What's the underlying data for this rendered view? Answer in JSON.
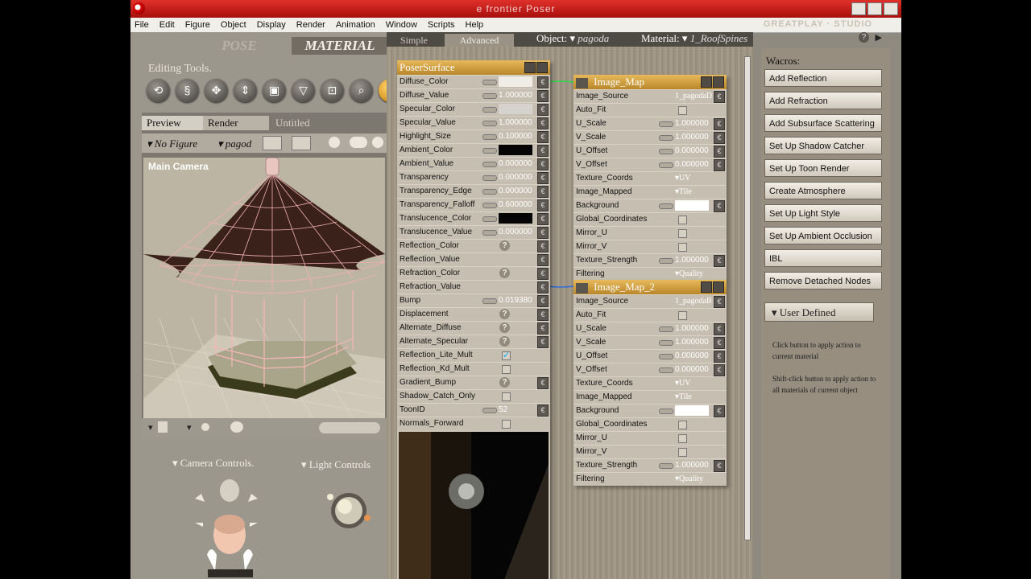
{
  "window": {
    "title": "e frontier Poser",
    "brand": "GREATPLAY · STUDIO"
  },
  "menu": [
    "File",
    "Edit",
    "Figure",
    "Object",
    "Display",
    "Render",
    "Animation",
    "Window",
    "Scripts",
    "Help"
  ],
  "rooms": {
    "pose": "POSE",
    "material": "MATERIAL"
  },
  "left": {
    "editing_label": "Editing Tools.",
    "tabs": {
      "preview": "Preview",
      "render": "Render",
      "untitled": "Untitled"
    },
    "figure_select": "No Figure",
    "object_select": "pagod",
    "camera_label": "Main Camera",
    "camera_controls": "Camera Controls.",
    "light_controls": "Light Controls"
  },
  "material_room": {
    "tabs": {
      "simple": "Simple",
      "advanced": "Advanced"
    },
    "object_label": "Object:",
    "object_value": "pagoda",
    "material_label": "Material:",
    "material_value": "1_RoofSpines"
  },
  "poser_surface": {
    "title": "PoserSurface",
    "rows": [
      {
        "label": "Diffuse_Color",
        "type": "color",
        "color": "#f0ede6"
      },
      {
        "label": "Diffuse_Value",
        "type": "num",
        "value": "1.000000"
      },
      {
        "label": "Specular_Color",
        "type": "color",
        "color": "#d6d3ce"
      },
      {
        "label": "Specular_Value",
        "type": "num",
        "value": "1.000000"
      },
      {
        "label": "Highlight_Size",
        "type": "num",
        "value": "0.100000"
      },
      {
        "label": "Ambient_Color",
        "type": "color",
        "color": "#050505"
      },
      {
        "label": "Ambient_Value",
        "type": "num",
        "value": "0.000000"
      },
      {
        "label": "Transparency",
        "type": "num",
        "value": "0.000000"
      },
      {
        "label": "Transparency_Edge",
        "type": "num",
        "value": "0.000000"
      },
      {
        "label": "Transparency_Falloff",
        "type": "num",
        "value": "0.600000"
      },
      {
        "label": "Translucence_Color",
        "type": "color",
        "color": "#050505"
      },
      {
        "label": "Translucence_Value",
        "type": "num",
        "value": "0.000000"
      },
      {
        "label": "Reflection_Color",
        "type": "q"
      },
      {
        "label": "Reflection_Value",
        "type": "none"
      },
      {
        "label": "Refraction_Color",
        "type": "q"
      },
      {
        "label": "Refraction_Value",
        "type": "none"
      },
      {
        "label": "Bump",
        "type": "num",
        "value": "0.019380"
      },
      {
        "label": "Displacement",
        "type": "q"
      },
      {
        "label": "Alternate_Diffuse",
        "type": "q"
      },
      {
        "label": "Alternate_Specular",
        "type": "q"
      },
      {
        "label": "Reflection_Lite_Mult",
        "type": "check",
        "checked": true
      },
      {
        "label": "Reflection_Kd_Mult",
        "type": "check",
        "checked": false
      },
      {
        "label": "Gradient_Bump",
        "type": "q"
      },
      {
        "label": "Shadow_Catch_Only",
        "type": "check",
        "checked": false
      },
      {
        "label": "ToonID",
        "type": "num",
        "value": "52"
      },
      {
        "label": "Normals_Forward",
        "type": "check",
        "checked": false
      }
    ]
  },
  "image_maps": [
    {
      "title": "Image_Map",
      "rows": [
        {
          "label": "Image_Source",
          "type": "text",
          "value": "1_pagodaD"
        },
        {
          "label": "Auto_Fit",
          "type": "check",
          "checked": false
        },
        {
          "label": "U_Scale",
          "type": "num",
          "value": "1.000000"
        },
        {
          "label": "V_Scale",
          "type": "num",
          "value": "1.000000"
        },
        {
          "label": "U_Offset",
          "type": "num",
          "value": "0.000000"
        },
        {
          "label": "V_Offset",
          "type": "num",
          "value": "0.000000"
        },
        {
          "label": "Texture_Coords",
          "type": "dd",
          "value": "UV"
        },
        {
          "label": "Image_Mapped",
          "type": "dd",
          "value": "Tile"
        },
        {
          "label": "Background",
          "type": "color",
          "color": "#ffffff"
        },
        {
          "label": "Global_Coordinates",
          "type": "check",
          "checked": false
        },
        {
          "label": "Mirror_U",
          "type": "check",
          "checked": false
        },
        {
          "label": "Mirror_V",
          "type": "check",
          "checked": false
        },
        {
          "label": "Texture_Strength",
          "type": "num",
          "value": "1.000000"
        },
        {
          "label": "Filtering",
          "type": "dd",
          "value": "Quality"
        }
      ]
    },
    {
      "title": "Image_Map_2",
      "rows": [
        {
          "label": "Image_Source",
          "type": "text",
          "value": "1_pagodaB"
        },
        {
          "label": "Auto_Fit",
          "type": "check",
          "checked": false
        },
        {
          "label": "U_Scale",
          "type": "num",
          "value": "1.000000"
        },
        {
          "label": "V_Scale",
          "type": "num",
          "value": "1.000000"
        },
        {
          "label": "U_Offset",
          "type": "num",
          "value": "0.000000"
        },
        {
          "label": "V_Offset",
          "type": "num",
          "value": "0.000000"
        },
        {
          "label": "Texture_Coords",
          "type": "dd",
          "value": "UV"
        },
        {
          "label": "Image_Mapped",
          "type": "dd",
          "value": "Tile"
        },
        {
          "label": "Background",
          "type": "color",
          "color": "#ffffff"
        },
        {
          "label": "Global_Coordinates",
          "type": "check",
          "checked": false
        },
        {
          "label": "Mirror_U",
          "type": "check",
          "checked": false
        },
        {
          "label": "Mirror_V",
          "type": "check",
          "checked": false
        },
        {
          "label": "Texture_Strength",
          "type": "num",
          "value": "1.000000"
        },
        {
          "label": "Filtering",
          "type": "dd",
          "value": "Quality"
        }
      ]
    }
  ],
  "wacros": {
    "title": "Wacros:",
    "buttons": [
      "Add Reflection",
      "Add Refraction",
      "Add Subsurface Scattering",
      "Set Up Shadow Catcher",
      "Set Up Toon Render",
      "Create Atmosphere",
      "Set Up Light Style",
      "Set Up Ambient Occlusion",
      "IBL",
      "Remove Detached Nodes"
    ],
    "user_defined": "User Defined",
    "note1": "Click button to apply action to current material",
    "note2": "Shift-click button to apply action to all materials of current object"
  },
  "colors": {
    "title_red": "#c81e18",
    "node_header": "#d5a443",
    "accent_blue": "#2a6bd9"
  }
}
